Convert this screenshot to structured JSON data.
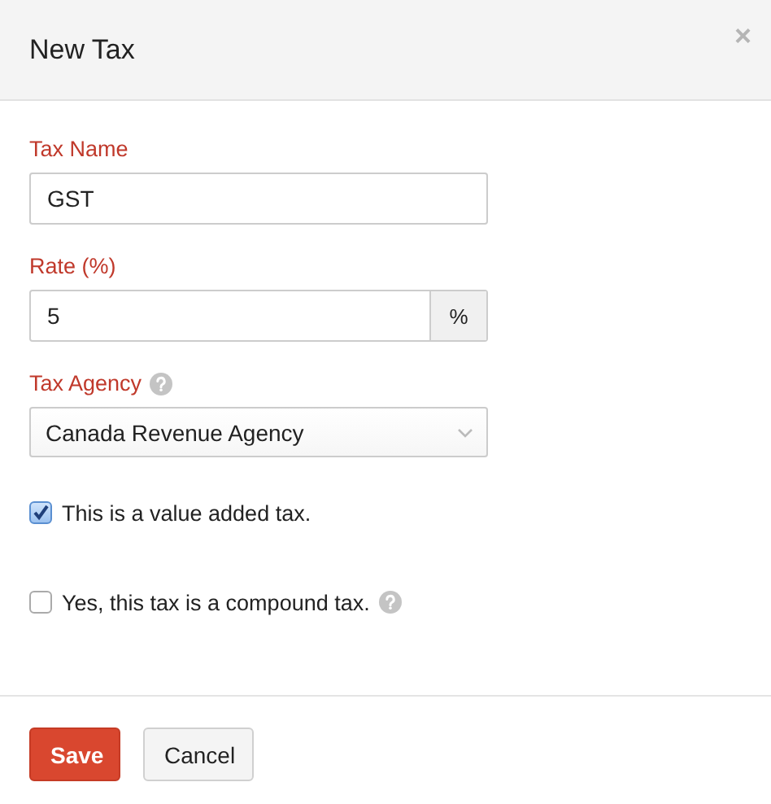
{
  "dialog": {
    "title": "New Tax",
    "close": "×"
  },
  "fields": [
    {
      "kind": "text",
      "label": "Tax Name",
      "value": "GST",
      "help": false
    },
    {
      "kind": "suffix",
      "label": "Rate (%)",
      "value": "5",
      "suffix": "%",
      "help": false
    },
    {
      "kind": "select",
      "label": "Tax Agency",
      "value": "Canada Revenue Agency",
      "help": true
    }
  ],
  "checkboxes": [
    {
      "label": "This is a value added tax.",
      "checked": true,
      "help": false
    },
    {
      "label": "Yes, this tax is a compound tax.",
      "checked": false,
      "help": true
    }
  ],
  "buttons": [
    {
      "label": "Save",
      "kind": "primary"
    },
    {
      "label": "Cancel",
      "kind": "secondary"
    }
  ]
}
